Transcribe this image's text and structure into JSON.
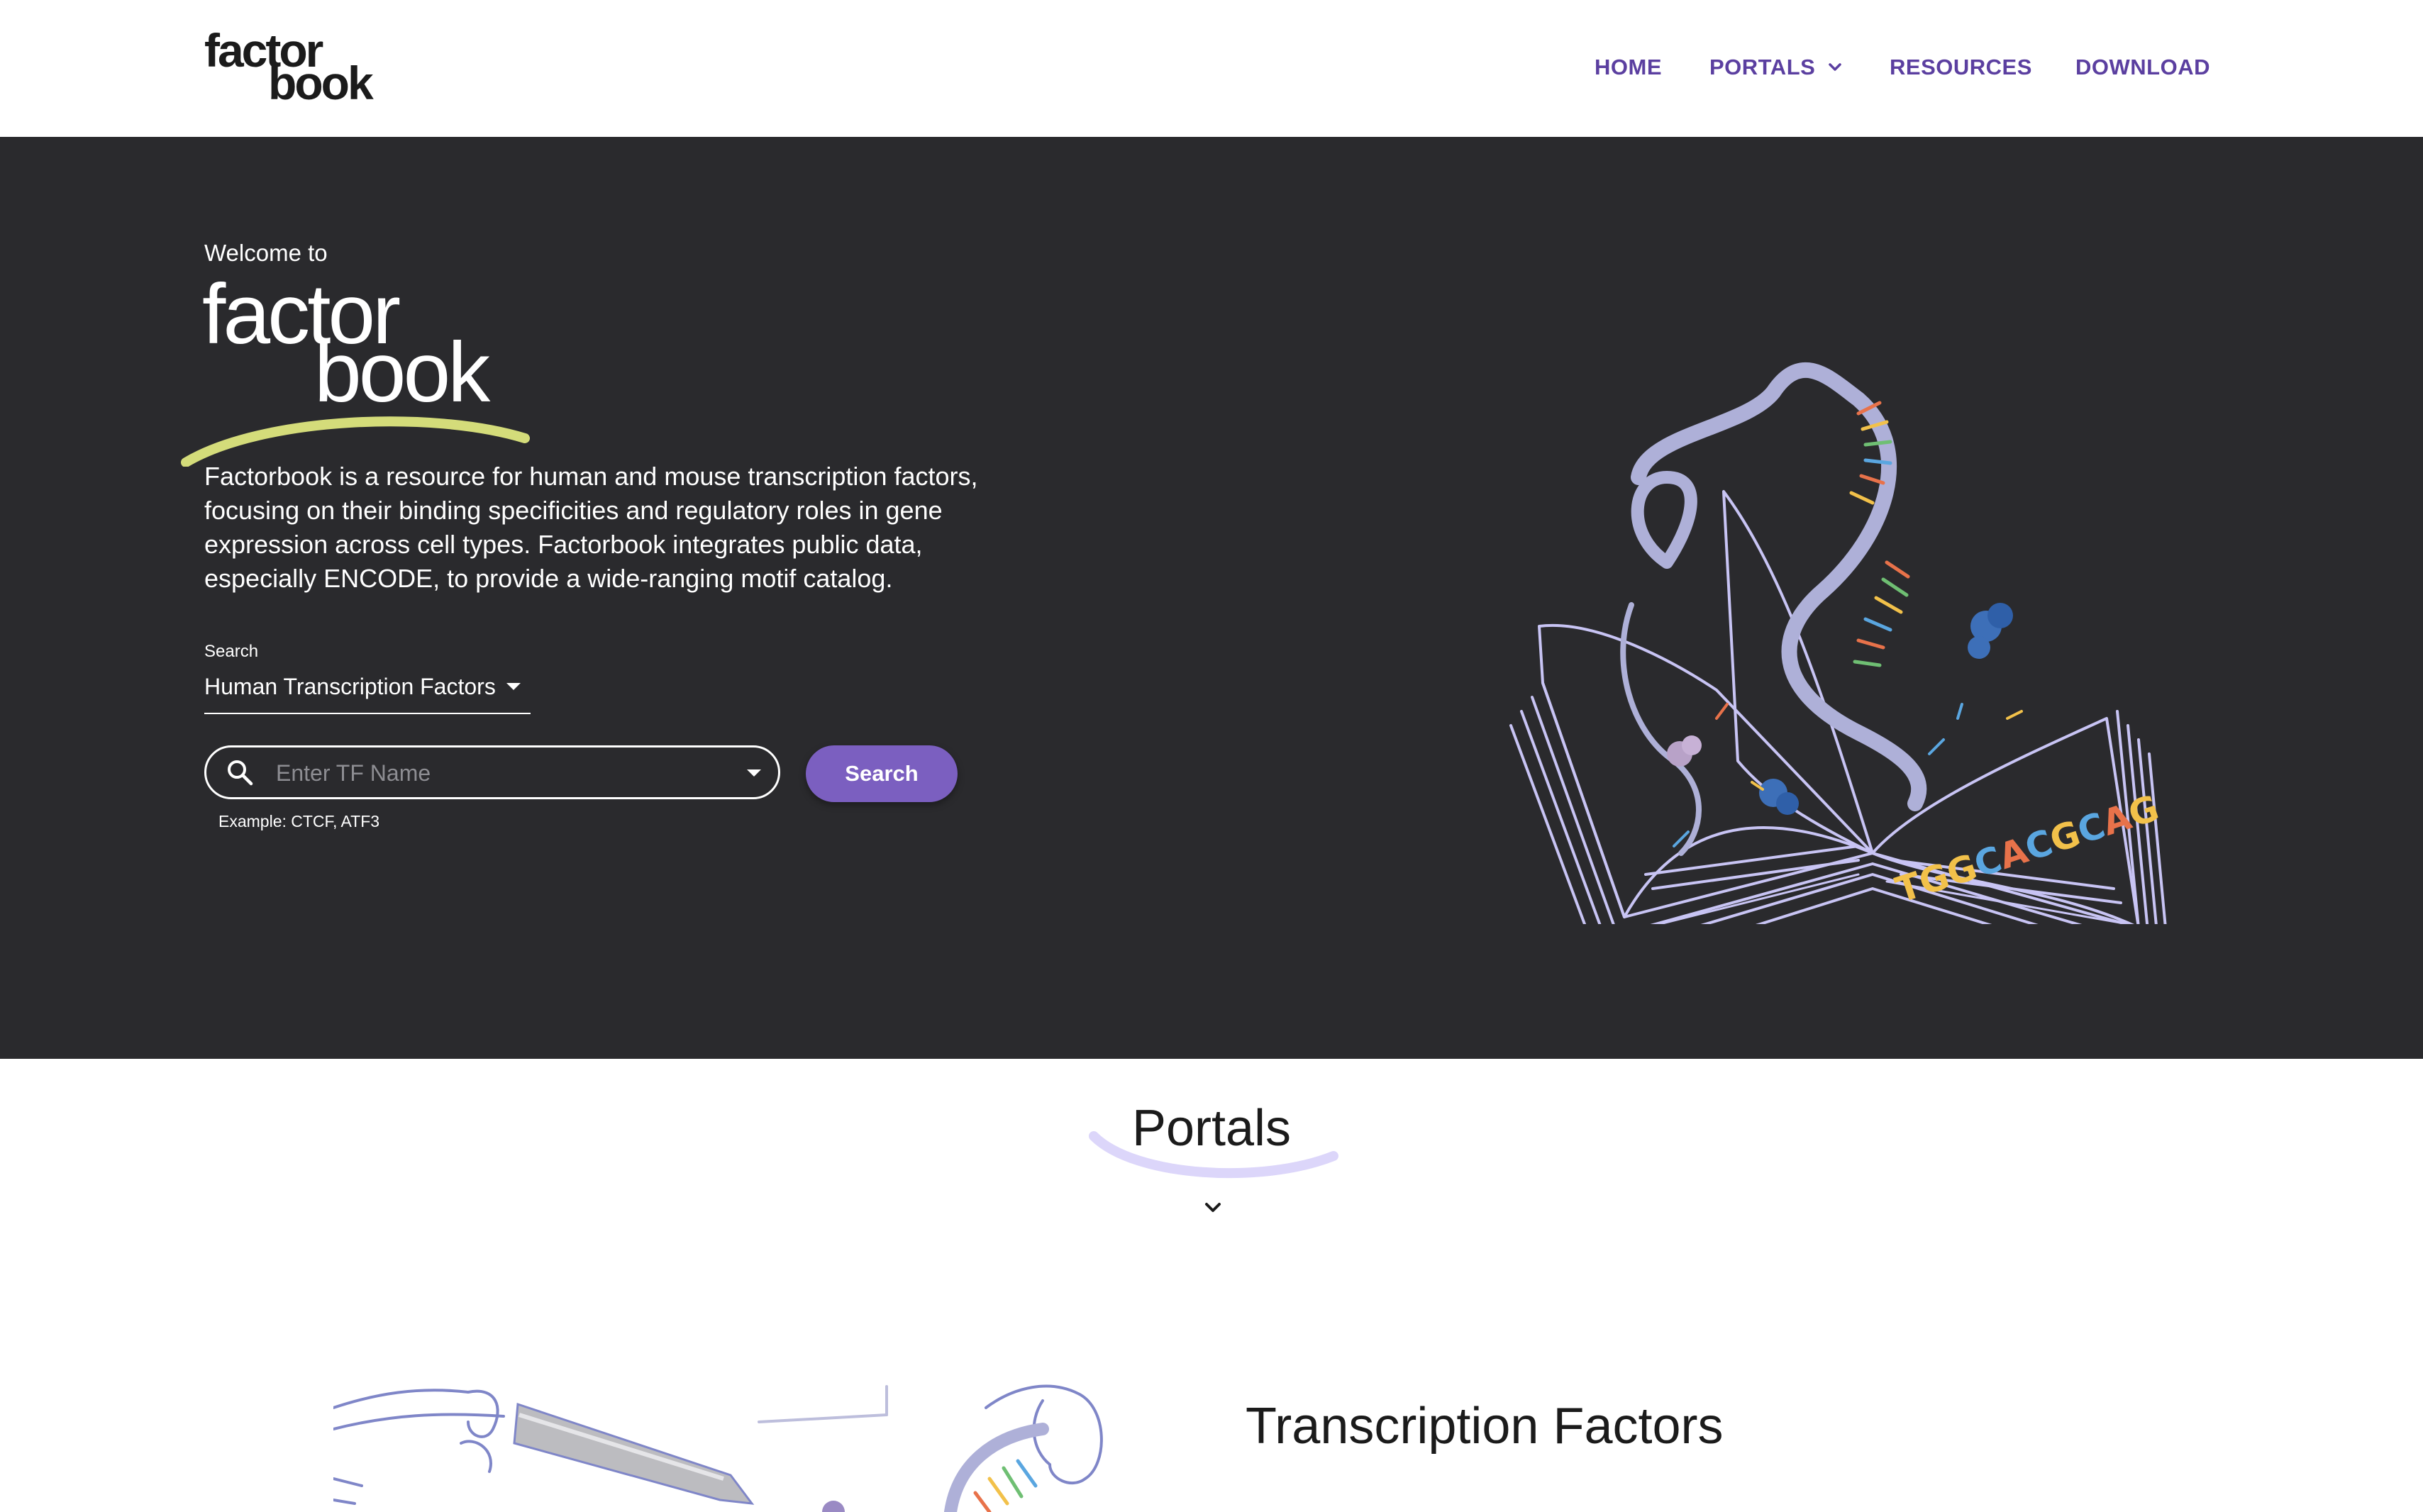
{
  "header": {
    "logo_line1": "factor",
    "logo_line2": "book",
    "nav": [
      {
        "label": "HOME"
      },
      {
        "label": "PORTALS"
      },
      {
        "label": "RESOURCES"
      },
      {
        "label": "DOWNLOAD"
      }
    ]
  },
  "hero": {
    "welcome": "Welcome to",
    "logo_line1": "factor",
    "logo_line2": "book",
    "description": "Factorbook is a resource for human and mouse transcription factors, focusing on their binding specificities and regulatory roles in gene expression across cell types. Factorbook integrates public data, especially ENCODE, to provide a wide-ranging motif catalog.",
    "search_label": "Search",
    "search_type_selected": "Human Transcription Factors",
    "input_placeholder": "Enter TF Name",
    "input_value": "",
    "search_button": "Search",
    "example": "Example: CTCF, ATF3",
    "illustration_sequence": "TGGCACGCAG"
  },
  "portals": {
    "title": "Portals",
    "first_portal_title": "Transcription Factors"
  },
  "colors": {
    "nav_text": "#5b3fa0",
    "hero_bg": "#2a2a2d",
    "button": "#7b5fc0",
    "logo_swoosh": "#d4dc7a",
    "portals_swoosh": "#dcd6fa"
  }
}
